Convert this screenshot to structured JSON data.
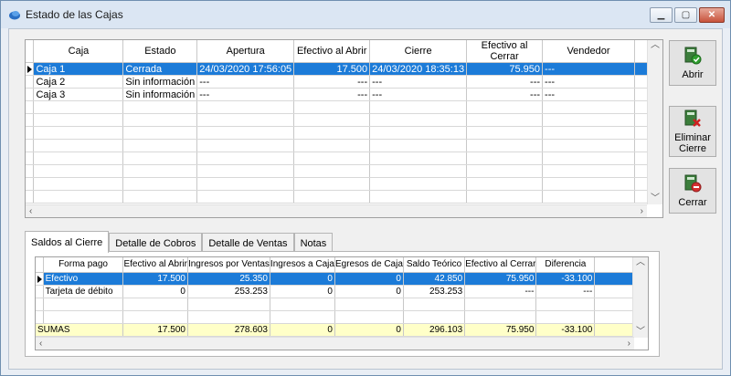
{
  "window": {
    "title": "Estado de las Cajas",
    "minimize": "▁",
    "maximize": "▢",
    "close": "✕"
  },
  "cajas": {
    "columns": [
      "Caja",
      "Estado",
      "Apertura",
      "Efectivo al Abrir",
      "Cierre",
      "Efectivo al Cerrar",
      "Vendedor"
    ],
    "rows": [
      [
        "Caja 1",
        "Cerrada",
        "24/03/2020 17:56:05",
        "17.500",
        "24/03/2020 18:35:13",
        "75.950",
        "---"
      ],
      [
        "Caja 2",
        "Sin información",
        "---",
        "---",
        "---",
        "---",
        "---"
      ],
      [
        "Caja 3",
        "Sin información",
        "---",
        "---",
        "---",
        "---",
        "---"
      ]
    ]
  },
  "actions": {
    "abrir": "Abrir",
    "eliminar_cierre": "Eliminar Cierre",
    "cerrar": "Cerrar"
  },
  "tabs": [
    "Saldos al Cierre",
    "Detalle de Cobros",
    "Detalle de Ventas",
    "Notas"
  ],
  "saldos": {
    "columns": [
      "Forma pago",
      "Efectivo al Abrir",
      "Ingresos por Ventas",
      "Ingresos a Caja",
      "Egresos de Caja",
      "Saldo Teórico",
      "Efectivo al Cerrar",
      "Diferencia"
    ],
    "rows": [
      [
        "Efectivo",
        "17.500",
        "25.350",
        "0",
        "0",
        "42.850",
        "75.950",
        "-33.100"
      ],
      [
        "Tarjeta de débito",
        "0",
        "253.253",
        "0",
        "0",
        "253.253",
        "---",
        "---"
      ]
    ],
    "sums": [
      "SUMAS",
      "17.500",
      "278.603",
      "0",
      "0",
      "296.103",
      "75.950",
      "-33.100"
    ]
  },
  "colors": {
    "selection": "#1c7bd8",
    "sum_row": "#ffffc8"
  }
}
